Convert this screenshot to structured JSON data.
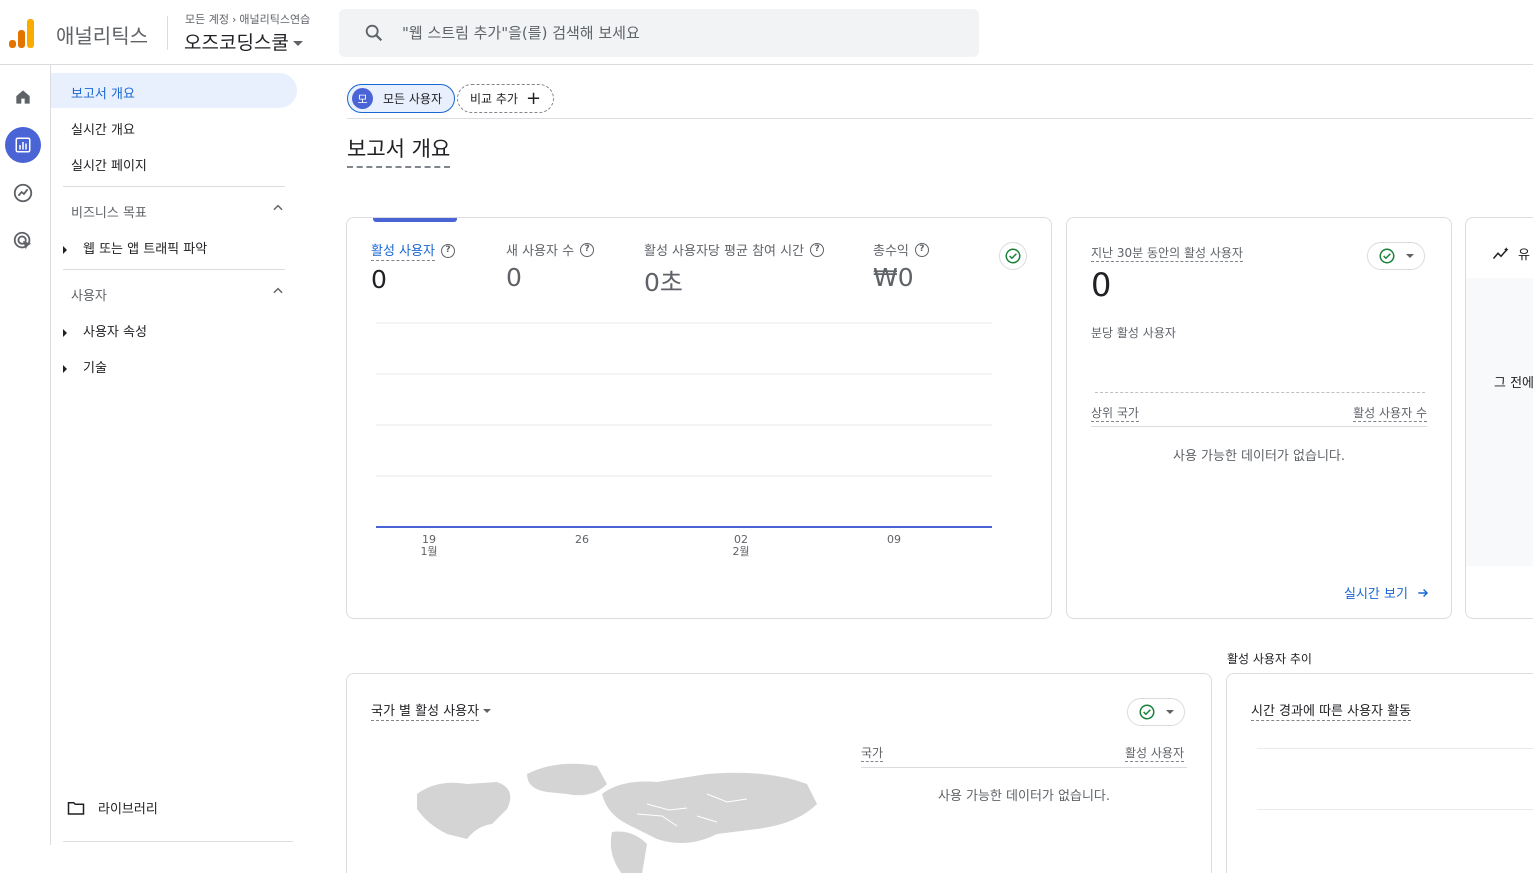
{
  "header": {
    "app_name": "애널리틱스",
    "breadcrumb_root": "모든 계정",
    "breadcrumb_account": "애널리틱스연습",
    "property_name": "오즈코딩스쿨",
    "search_placeholder": "\"웹 스트림 추가\"을(를) 검색해 보세요"
  },
  "sidebar": {
    "items": [
      {
        "label": "보고서 개요"
      },
      {
        "label": "실시간 개요"
      },
      {
        "label": "실시간 페이지"
      }
    ],
    "sections": [
      {
        "title": "비즈니스 목표",
        "children": [
          {
            "label": "웹 또는 앱 트래픽 파악"
          }
        ]
      },
      {
        "title": "사용자",
        "children": [
          {
            "label": "사용자 속성"
          },
          {
            "label": "기술"
          }
        ]
      }
    ],
    "library": "라이브러리"
  },
  "compare": {
    "all_users_avatar": "모",
    "all_users": "모든 사용자",
    "add_compare": "비교 추가"
  },
  "page_title": "보고서 개요",
  "metrics_card": {
    "metrics": [
      {
        "label": "활성 사용자",
        "value": "0"
      },
      {
        "label": "새 사용자 수",
        "value": "0"
      },
      {
        "label": "활성 사용자당 평균 참여 시간",
        "value": "0초"
      },
      {
        "label": "총수익",
        "value": "₩0"
      }
    ],
    "chart_data": {
      "type": "line",
      "x": [
        "1월 19",
        "1월 26",
        "2월 02",
        "2월 09"
      ],
      "series": [
        {
          "values": [
            0,
            0,
            0,
            0
          ]
        }
      ],
      "x_ticks": [
        {
          "day": "19",
          "month": "1월"
        },
        {
          "day": "26",
          "month": ""
        },
        {
          "day": "02",
          "month": "2월"
        },
        {
          "day": "09",
          "month": ""
        }
      ],
      "grid": true
    }
  },
  "realtime_card": {
    "title": "지난 30분 동안의 활성 사용자",
    "value": "0",
    "sub_label": "분당 활성 사용자",
    "col_country": "상위 국가",
    "col_users": "활성 사용자 수",
    "empty": "사용 가능한 데이터가 없습니다.",
    "link": "실시간 보기"
  },
  "partial_card": {
    "header_text": "유",
    "body_text": "그 전에"
  },
  "country_card": {
    "title": "국가 별 활성 사용자",
    "col_country": "국가",
    "col_users": "활성 사용자",
    "empty": "사용 가능한 데이터가 없습니다."
  },
  "trend_section": {
    "section_label": "활성 사용자 추이",
    "title": "시간 경과에 따른 사용자 활동"
  },
  "colors": {
    "accent": "#1967d2",
    "chart_line": "#4a64d6",
    "success": "#188038",
    "logo_orange": "#e37400",
    "logo_yellow": "#f9ab00"
  }
}
